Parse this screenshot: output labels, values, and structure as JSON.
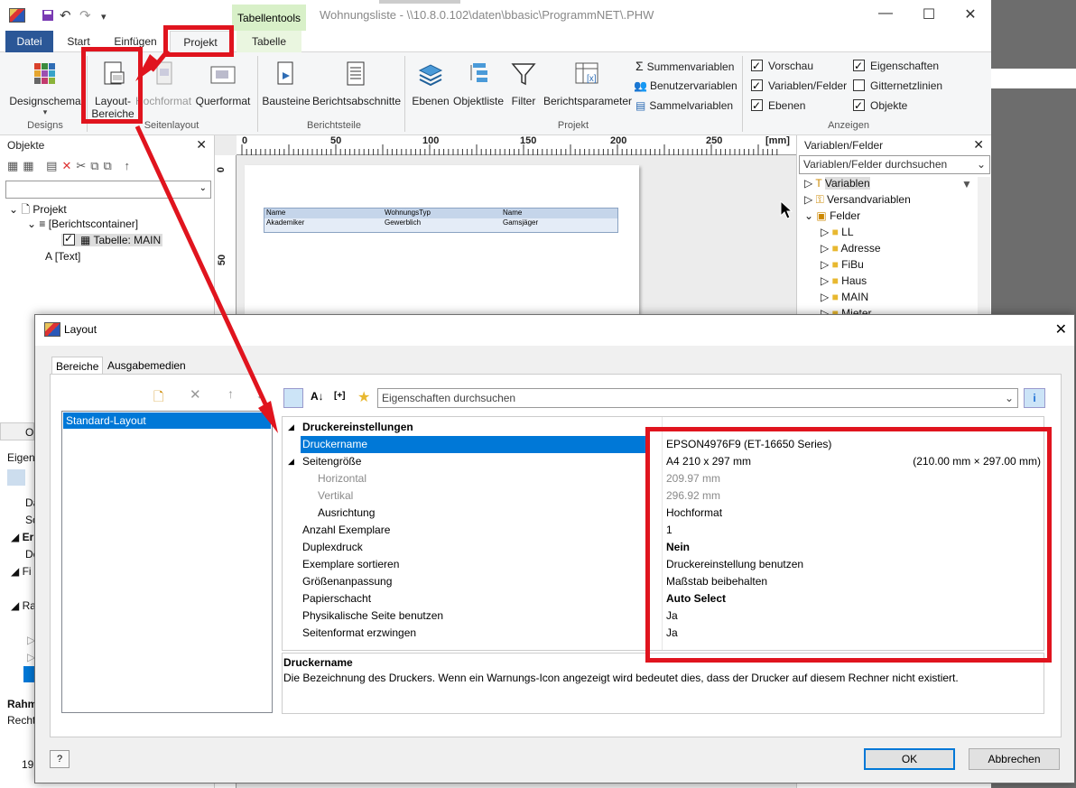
{
  "window": {
    "title": "Wohnungsliste - \\\\10.8.0.102\\daten\\bbasic\\ProgrammNET\\.PHW",
    "context_tab_group": "Tabellentools",
    "controls": {
      "minimize": "—",
      "maximize": "☐",
      "close": "✕"
    },
    "qat": {
      "undo": "↶",
      "redo": "↷",
      "dropdown": "▾"
    }
  },
  "ribbon_tabs": [
    "Datei",
    "Start",
    "Einfügen",
    "Projekt",
    "Tabelle"
  ],
  "ribbon": {
    "designs": {
      "button": "Designschema",
      "group": "Designs"
    },
    "seitenlayout": {
      "layout_line1": "Layout-",
      "layout_line2": "Bereiche",
      "hochformat": "Hochformat",
      "querformat": "Querformat",
      "group": "Seitenlayout"
    },
    "berichtsteile": {
      "bausteine": "Bausteine",
      "berichtsabschnitte": "Berichtsabschnitte",
      "group": "Berichtsteile"
    },
    "projekt": {
      "ebenen": "Ebenen",
      "objektliste": "Objektliste",
      "filter": "Filter",
      "berichtsparameter": "Berichtsparameter",
      "summen": "Summenvariablen",
      "benutzer": "Benutzervariablen",
      "sammel": "Sammelvariablen",
      "group": "Projekt"
    },
    "anzeigen": {
      "items": [
        {
          "label": "Vorschau",
          "checked": true
        },
        {
          "label": "Variablen/Felder",
          "checked": true
        },
        {
          "label": "Ebenen",
          "checked": true
        },
        {
          "label": "Eigenschaften",
          "checked": true
        },
        {
          "label": "Gitternetzlinien",
          "checked": false
        },
        {
          "label": "Objekte",
          "checked": true
        }
      ],
      "group": "Anzeigen"
    }
  },
  "objects_panel": {
    "title": "Objekte",
    "tree": [
      "Projekt",
      "[Berichtscontainer]",
      "Tabelle: MAIN",
      "[Text]"
    ],
    "lower_fragments": [
      "Ol",
      "Eigens",
      "Da",
      "Sc",
      "Er",
      "De",
      "Fi",
      "Ra",
      "Rahm",
      "Rechts",
      "19"
    ]
  },
  "ruler": {
    "top": [
      "0",
      "50",
      "100",
      "150",
      "200",
      "250",
      "[mm]"
    ],
    "left": [
      "0",
      "50"
    ]
  },
  "report_table": {
    "headers": [
      "Name",
      "WohnungsTyp",
      "Name"
    ],
    "row": [
      "Akademiker",
      "Gewerblich",
      "Gamsjäger"
    ]
  },
  "fields_panel": {
    "title": "Variablen/Felder",
    "search_placeholder": "Variablen/Felder durchsuchen",
    "tree": [
      "Variablen",
      "Versandvariablen",
      "Felder",
      "LL",
      "Adresse",
      "FiBu",
      "Haus",
      "MAIN",
      "Mieter"
    ]
  },
  "background_window_fragment": "Variablen",
  "dialog": {
    "title": "Layout",
    "tabs": [
      "Bereiche",
      "Ausgabemedien"
    ],
    "layout_list": [
      "Standard-Layout"
    ],
    "search_placeholder": "Eigenschaften durchsuchen",
    "section": "Druckereinstellungen",
    "properties": [
      {
        "name": "Druckername",
        "value": "EPSON4976F9 (ET-16650 Series)",
        "selected": true
      },
      {
        "name": "Seitengröße",
        "value": "A4 210 x 297 mm",
        "extra": "(210.00 mm × 297.00 mm)"
      },
      {
        "name": "Horizontal",
        "value": "209.97 mm",
        "sub": true,
        "grey": true
      },
      {
        "name": "Vertikal",
        "value": "296.92 mm",
        "sub": true,
        "grey": true
      },
      {
        "name": "Ausrichtung",
        "value": "Hochformat",
        "sub": true
      },
      {
        "name": "Anzahl Exemplare",
        "value": "1"
      },
      {
        "name": "Duplexdruck",
        "value": "Nein",
        "bold": true
      },
      {
        "name": "Exemplare sortieren",
        "value": "Druckereinstellung benutzen"
      },
      {
        "name": "Größenanpassung",
        "value": "Maßstab beibehalten"
      },
      {
        "name": "Papierschacht",
        "value": "Auto Select",
        "bold": true
      },
      {
        "name": "Physikalische Seite benutzen",
        "value": "Ja"
      },
      {
        "name": "Seitenformat erzwingen",
        "value": "Ja"
      }
    ],
    "description_title": "Druckername",
    "description_text": "Die Bezeichnung des Druckers. Wenn ein Warnungs-Icon angezeigt wird bedeutet dies, dass der Drucker auf diesem Rechner nicht existiert.",
    "ok": "OK",
    "cancel": "Abbrechen"
  },
  "colors": {
    "accent": "#0078d7",
    "file_tab": "#2b5797",
    "annotation_red": "#e0141e",
    "context_tab": "#d8f0c8"
  }
}
